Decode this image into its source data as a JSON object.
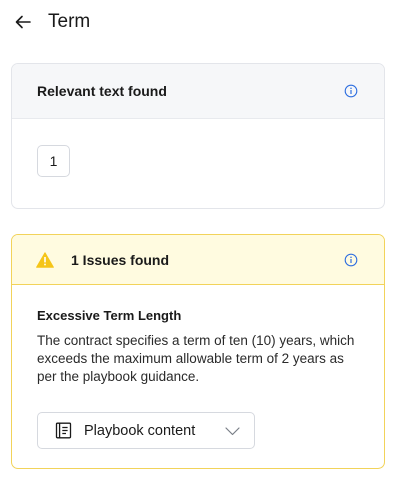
{
  "header": {
    "title": "Term"
  },
  "relevant": {
    "title": "Relevant text found",
    "count": "1"
  },
  "issues": {
    "title": "1 Issues found",
    "items": [
      {
        "title": "Excessive Term Length",
        "description": "The contract specifies a term of ten (10) years, which exceeds the maximum allowable term of 2 years as per the playbook guidance.",
        "dropdown_label": "Playbook content"
      }
    ]
  },
  "colors": {
    "accent_blue": "#2f6fe0",
    "warning_yellow": "#f5c518",
    "warning_bg": "#fffbe0",
    "warning_border": "#f2d35a"
  },
  "icons": [
    "back-arrow-icon",
    "info-icon",
    "warning-icon",
    "book-icon",
    "chevron-down-icon"
  ]
}
